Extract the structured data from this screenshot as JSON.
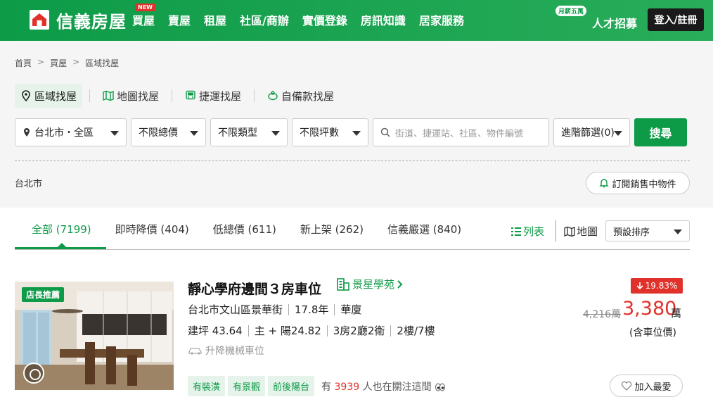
{
  "header": {
    "brand": "信義房屋",
    "nav": [
      {
        "label": "買屋",
        "badge": "NEW"
      },
      {
        "label": "賣屋"
      },
      {
        "label": "租屋"
      },
      {
        "label": "社區/商辦"
      },
      {
        "label": "實價登錄"
      },
      {
        "label": "房訊知識"
      },
      {
        "label": "居家服務"
      }
    ],
    "career_badge": "月薪五萬",
    "career_label": "人才招募",
    "login": "登入/註冊"
  },
  "breadcrumb": [
    "首頁",
    "買屋",
    "區域找屋"
  ],
  "breadcrumb_sep": ">",
  "search_tabs": [
    "區域找屋",
    "地圖找屋",
    "捷運找屋",
    "自備款找屋"
  ],
  "filters": {
    "region": "台北市・全區",
    "price": "不限總價",
    "type": "不限類型",
    "size": "不限坪數",
    "search_placeholder": "街道、捷運站、社區、物件編號",
    "advanced": "進階篩選(0)",
    "search_btn": "搜尋"
  },
  "city_label": "台北市",
  "subscribe": "訂閱銷售中物件",
  "result_tabs": [
    "全部 (7199)",
    "即時降價 (404)",
    "低總價 (611)",
    "新上架 (262)",
    "信義嚴選 (840)"
  ],
  "view": {
    "list": "列表",
    "map": "地圖",
    "sort": "預設排序"
  },
  "listing": {
    "photo_badge": "店長推薦",
    "title": "靜心學府邊間３房車位",
    "community": "景星學苑",
    "address": "台北市文山區景華街",
    "age": "17.8年",
    "building_type": "華廈",
    "area": "建坪 43.64",
    "main_area": "主 + 陽24.82",
    "layout": "3房2廳2衛",
    "floor": "2樓/7樓",
    "parking": "升降機械車位",
    "tags": [
      "有裝潢",
      "有景觀",
      "前後陽台"
    ],
    "watch_prefix": "有",
    "watch_count": "3939",
    "watch_suffix": "人也在關注這間",
    "discount": "19.83%",
    "price_old": "4,216萬",
    "price_new": "3,380",
    "price_unit": "萬",
    "price_note": "(含車位價)",
    "favorite": "加入最愛"
  },
  "colors": {
    "brand_green": "#0d9b48",
    "accent_red": "#e0322a"
  }
}
